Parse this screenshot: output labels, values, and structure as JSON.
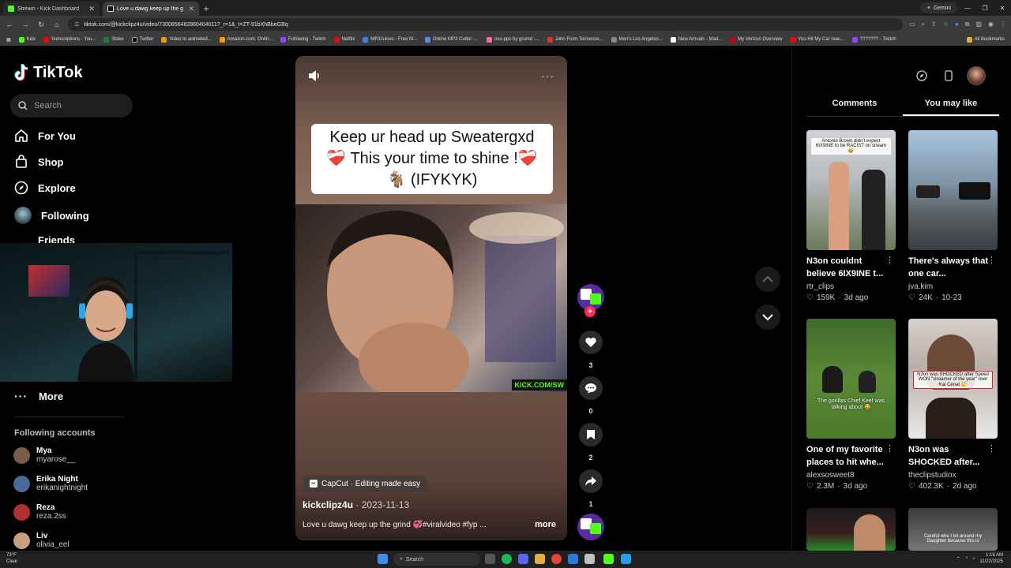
{
  "browser": {
    "tabs": [
      {
        "title": "Stream - Kick Dashboard",
        "active": false
      },
      {
        "title": "Love u dawg keep up the g",
        "active": true
      }
    ],
    "url": "tiktok.com/@kickclipz4u/video/7300856482860404011?_r=1&_t=ZT-91bXhBbeGBq",
    "gemini_label": "Gemini",
    "bookmarks": [
      "Kick",
      "Subscriptions - You...",
      "Stake",
      "Twitter",
      "Video to animated...",
      "Amazon.com: Onlin...",
      "Following - Twitch",
      "Netflix",
      "MP3Juices - Free M...",
      "Online MP3 Cutter -...",
      "osu-pps by grumd -...",
      "John From Tennesse...",
      "Men's Los Angeles...",
      "New Arrivals - Mad...",
      "My Verizon Overview",
      "You Hit My Car reac...",
      "??????? - Twitch"
    ],
    "all_bookmarks": "All Bookmarks"
  },
  "tiktok": {
    "logo": "TikTok",
    "search_placeholder": "Search",
    "nav": [
      "For You",
      "Shop",
      "Explore",
      "Following",
      "Friends"
    ],
    "more_label": "More",
    "following_title": "Following accounts",
    "accounts": [
      {
        "name": "Mya",
        "handle": "myarose__",
        "color": "#7a5a4a"
      },
      {
        "name": "Erika Night",
        "handle": "erikanightnight",
        "color": "#4a6a9a"
      },
      {
        "name": "Reza",
        "handle": "reza.2ss",
        "color": "#b03030"
      },
      {
        "name": "Liv",
        "handle": "olivia_eel",
        "color": "#c8a080"
      }
    ]
  },
  "video": {
    "caption_line1": "Keep ur head up Sweatergxd",
    "caption_line2": "❤️‍🩹 This your time to shine !❤️‍🩹",
    "caption_line3": "🐐 (IFYKYK)",
    "watermark": "KICK.COM/SW",
    "capcut_label": "CapCut · Editing made easy",
    "author": "kickclipz4u",
    "date": "2023-11-13",
    "description": "Love u dawg keep up the grind 💞#viralvideo #fyp ...",
    "more_label": "more",
    "likes": "3",
    "comments": "0",
    "saves": "2",
    "shares": "1"
  },
  "right_panel": {
    "tabs": [
      "Comments",
      "You may like"
    ],
    "active_tab": "You may like",
    "cards": [
      {
        "title": "N3on couldnt believe 6IX9INE t...",
        "author": "rtr_clips",
        "likes": "159K",
        "age": "3d ago",
        "overlay": "Antonio Brown didn't expect 6IX9INE to be RACIST on stream 😂"
      },
      {
        "title": "There's always that one car...",
        "author": "jva.kim",
        "likes": "24K",
        "age": "10-23",
        "overlay": ""
      },
      {
        "title": "One of my favorite places to hit whe...",
        "author": "alexsosweet8",
        "likes": "2.3M",
        "age": "3d ago",
        "overlay": "The gorillas Chief Keef was talking about 😂"
      },
      {
        "title": "N3on was SHOCKED after...",
        "author": "theclipstudiox",
        "likes": "402.3K",
        "age": "2d ago",
        "overlay": "N3on was SHOCKED after Speed WON \"streamer of the year\" over Kai Cenat 😳"
      },
      {
        "title": "",
        "author": "",
        "likes": "",
        "age": "",
        "overlay": ""
      },
      {
        "title": "",
        "author": "",
        "likes": "",
        "age": "",
        "overlay": "Careful who I let around my Daughter because this is"
      }
    ]
  },
  "taskbar": {
    "weather_temp": "73°F",
    "weather_desc": "Clear",
    "search_label": "Search",
    "time": "1:16 AM",
    "date": "11/22/2025"
  }
}
